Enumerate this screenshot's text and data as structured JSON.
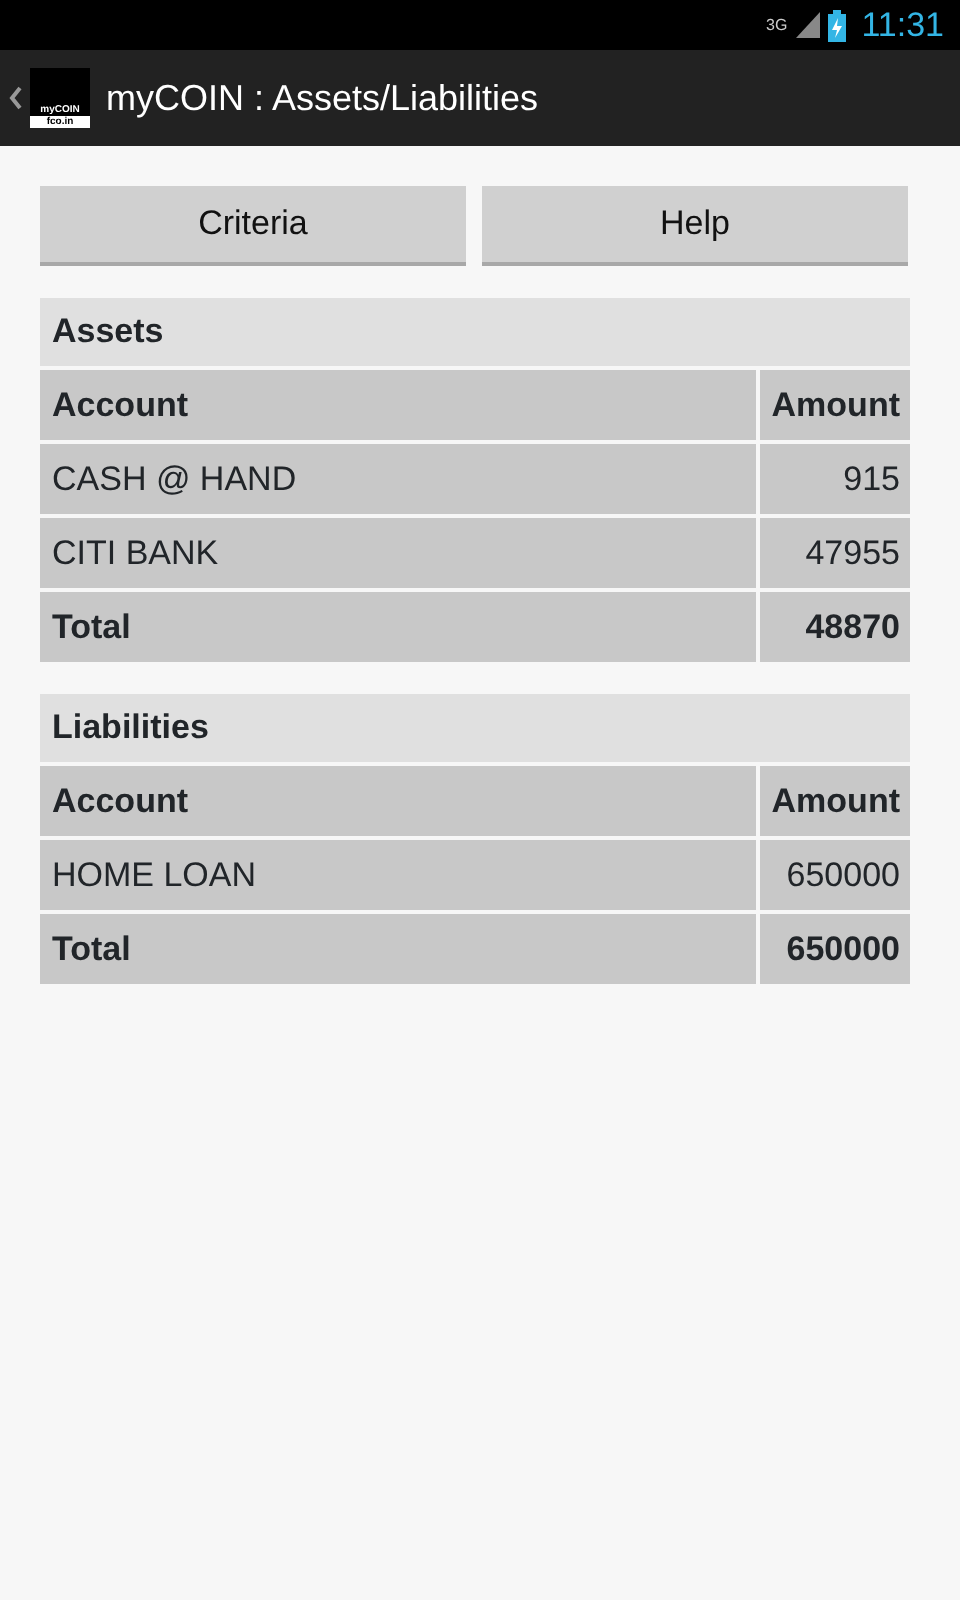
{
  "status_bar": {
    "network": "3G",
    "time": "11:31"
  },
  "action_bar": {
    "logo_lines": [
      "myCOIN",
      "fco.in"
    ],
    "title": "myCOIN : Assets/Liabilities"
  },
  "buttons": [
    "Criteria",
    "Help"
  ],
  "sections": [
    {
      "title": "Assets",
      "columns": [
        "Account",
        "Amount"
      ],
      "rows": [
        {
          "kind": "item",
          "cells": [
            "CASH @ HAND",
            "915"
          ]
        },
        {
          "kind": "item",
          "cells": [
            "CITI BANK",
            "47955"
          ]
        },
        {
          "kind": "total",
          "cells": [
            "Total",
            "48870"
          ]
        }
      ]
    },
    {
      "title": "Liabilities",
      "columns": [
        "Account",
        "Amount"
      ],
      "rows": [
        {
          "kind": "item",
          "cells": [
            "HOME LOAN",
            "650000"
          ]
        },
        {
          "kind": "total",
          "cells": [
            "Total",
            "650000"
          ]
        }
      ]
    }
  ]
}
